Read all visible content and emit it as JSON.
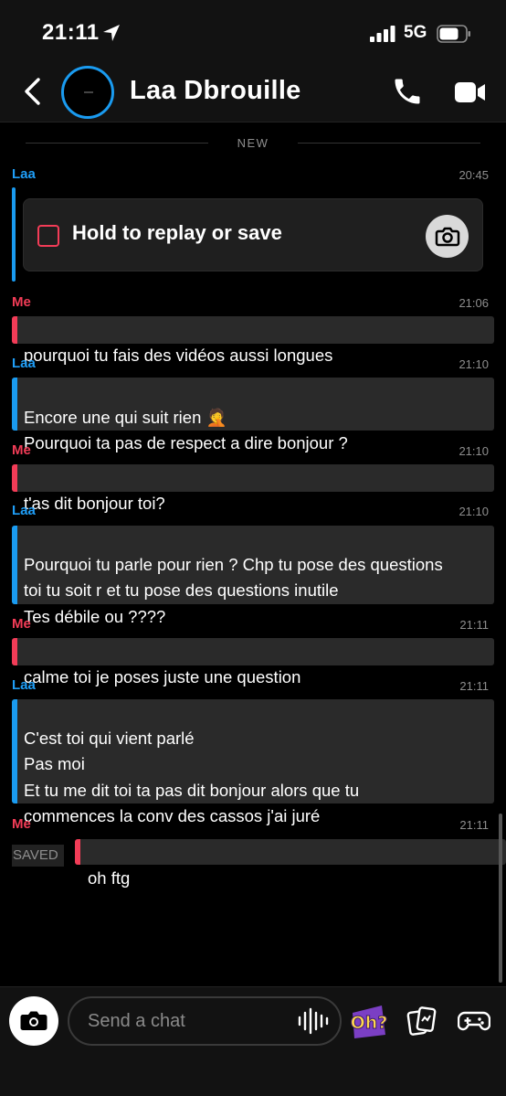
{
  "status_bar": {
    "time": "21:11",
    "network": "5G"
  },
  "header": {
    "contact_name": "Laa Dbrouille"
  },
  "chat": {
    "new_divider": "NEW",
    "snap": {
      "label": "Hold to replay or save"
    },
    "messages": [
      {
        "sender": "Laa",
        "time": "20:45"
      },
      {
        "sender": "Me",
        "time": "21:06",
        "text": "pourquoi tu fais des vidéos aussi longues"
      },
      {
        "sender": "Laa",
        "time": "21:10",
        "text": "Encore une qui suit rien 🤦\nPourquoi ta pas de respect a dire bonjour ?"
      },
      {
        "sender": "Me",
        "time": "21:10",
        "text": "t'as dit bonjour toi?"
      },
      {
        "sender": "Laa",
        "time": "21:10",
        "text": "Pourquoi tu parle pour rien ? Chp tu pose des questions\ntoi tu soit r et tu pose des questions inutile\nTes débile ou ????"
      },
      {
        "sender": "Me",
        "time": "21:11",
        "text": "calme toi je poses juste une question"
      },
      {
        "sender": "Laa",
        "time": "21:11",
        "text": "C'est toi qui  vient  parlé\nPas moi\nEt tu me dit toi ta pas dit bonjour alors que tu\ncommences la conv des cassos j'ai juré"
      },
      {
        "sender": "Me",
        "time": "21:11",
        "text": "oh ftg",
        "saved_label": "SAVED"
      }
    ]
  },
  "footer": {
    "input_placeholder": "Send a chat",
    "sticker_text": "Oh?"
  },
  "colors": {
    "friend": "#1a9bf0",
    "me": "#f23c57",
    "bubble": "#2a2a2a",
    "background": "#000000"
  }
}
